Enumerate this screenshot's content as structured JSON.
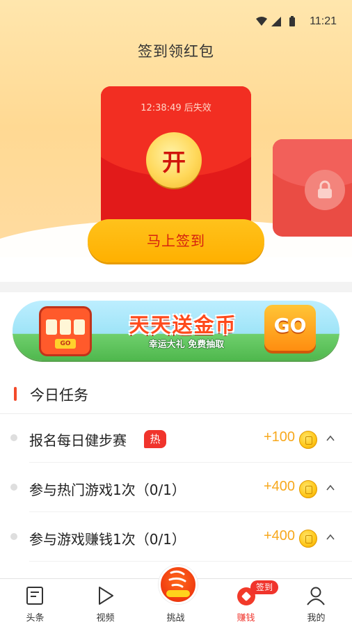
{
  "status_bar": {
    "time": "11:21"
  },
  "header": {
    "title": "签到领红包"
  },
  "envelope": {
    "timer": "12:38:49 后失效",
    "open_label": "开"
  },
  "signin_button_label": "马上签到",
  "banner": {
    "title": "天天送金币",
    "subtitle": "幸运大礼 免费抽取",
    "go_label": "GO",
    "slot_go": "GO"
  },
  "tasks": {
    "section_title": "今日任务",
    "items": [
      {
        "label": "报名每日健步赛",
        "badge": "热",
        "reward": "+100"
      },
      {
        "label": "参与热门游戏1次（0/1）",
        "reward": "+400"
      },
      {
        "label": "参与游戏赚钱1次（0/1）",
        "reward": "+400"
      }
    ]
  },
  "bottom_nav": {
    "items": [
      {
        "label": "头条",
        "icon": "news-icon"
      },
      {
        "label": "视频",
        "icon": "play-icon"
      },
      {
        "label": "挑战",
        "icon": "challenge-icon"
      },
      {
        "label": "赚钱",
        "icon": "earn-icon",
        "active": true
      },
      {
        "label": "我的",
        "icon": "profile-icon"
      }
    ],
    "signin_badge": "签到"
  },
  "colors": {
    "accent_red": "#f0342c",
    "reward_orange": "#f7a81d",
    "button_yellow": "#ffb000"
  }
}
